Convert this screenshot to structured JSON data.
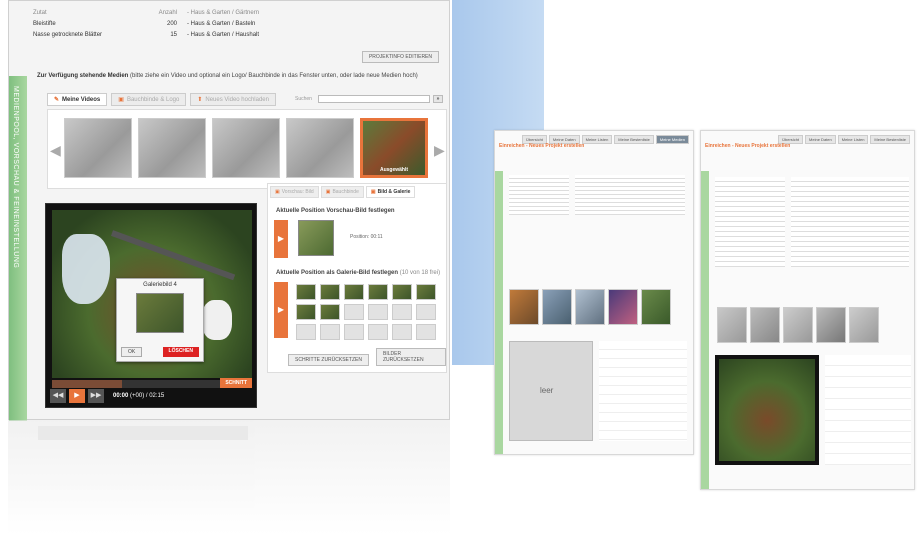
{
  "project": {
    "headers": [
      "Zutat",
      "Anzahl",
      "- Haus & Garten / Gärtnern"
    ],
    "rows": [
      {
        "name": "Bleistifte",
        "qty": "200",
        "category": "- Haus & Garten / Basteln"
      },
      {
        "name": "Nasse getrocknete Blätter",
        "qty": "15",
        "category": "- Haus & Garten / Haushalt"
      }
    ],
    "edit_label": "PROJEKTINFO EDITIEREN"
  },
  "side_strip_label": "MEDIENPOOL, VORSCHAU & FEINEINSTELLUNG",
  "media": {
    "title": "Zur Verfügung stehende Medien",
    "hint": "(bitte ziehe ein Video und optional ein Logo/ Bauchbinde in das Fenster unten, oder lade neue Medien hoch)",
    "tabs": [
      "Meine Videos",
      "Bauchbinde & Logo",
      "Neues Video hochladen"
    ],
    "search_label": "Suchen",
    "search_btn": "»",
    "selected_caption": "Ausgewählt"
  },
  "player": {
    "dialog_title": "Galeriebild 4",
    "ok_label": "OK",
    "delete_label": "LÖSCHEN",
    "scene_label": "SCHNITT",
    "time_current": "00:00",
    "time_rest": "(+00) / 02:15",
    "progress": 0.35
  },
  "right_panel": {
    "tabs": [
      "Vorschau: Bild",
      "Bauchbinde",
      "Bild & Galerie"
    ],
    "preview_title": "Aktuelle Position Vorschau-Bild festlegen",
    "position_label": "Position: 00:11",
    "gallery_title": "Aktuelle Position als Galerie-Bild festlegen",
    "gallery_hint": "(10 von 18 frei)",
    "reset_steps": "SCHRITTE ZURÜCKSETZEN",
    "reset_images": "BILDER ZURÜCKSETZEN"
  },
  "screen_a": {
    "nav": [
      "Übersicht",
      "Meine Daten",
      "Meine Listen",
      "Meine Bestenliste",
      "Meine Medien"
    ],
    "header": "Einreichen - Neues Projekt erstellen",
    "empty_label": "leer"
  },
  "screen_b": {
    "nav": [
      "Übersicht",
      "Meine Daten",
      "Meine Listen",
      "Meine Bestenliste"
    ],
    "header": "Einreichen - Neues Projekt erstellen"
  }
}
